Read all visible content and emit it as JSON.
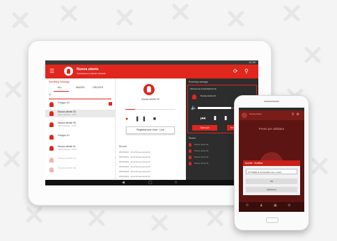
{
  "tablet": {
    "status_time": "12:30",
    "app_title": "Nuova utente",
    "app_subtitle": "Connessa a utente recente",
    "left": {
      "header": "SendMsg message",
      "tabs": [
        "ALL",
        "WAKES",
        "GROUPS"
      ],
      "groups": [
        {
          "name": "Gruppo 10",
          "date": ""
        },
        {
          "name": "Nuova utente 03",
          "date": "Ultimo accesso · 12:00"
        },
        {
          "name": "Nuova utente 05",
          "date": "Ultimo accesso · 12:00"
        },
        {
          "name": "Gruppo 10",
          "date": ""
        },
        {
          "name": "Nuova utente 01",
          "date": "Ultimo accesso · 12:00"
        },
        {
          "name": "Nuova utente 04",
          "date": ""
        },
        {
          "name": "Nuova utente 06",
          "date": ""
        }
      ]
    },
    "middle": {
      "label": "Nuova utente 03",
      "register_button": "Registrazione Voce · Live",
      "recent_label": "Recent",
      "recent_items": [
        "05/15/2016 · 10:12 Nuova utente 02",
        "05/15/2016 · 10:12 Nuova utente 02",
        "05/15/2016 · 10:12 Nuova utente 02",
        "05/15/2016 · 10:12 Nuova utente 02",
        "05/15/2016 · 10:12 Nuova utente 02",
        "05/15/2016 · 10:12 Nuova utente 02"
      ]
    },
    "right": {
      "header": "Receiving message",
      "box_header": "MESSAGE INTERMEDIATE",
      "message_from": "Nuova utente 01",
      "buttons": [
        "Salva pin",
        "Invia Trasmissione"
      ],
      "recent_label": "Recent",
      "recent_items": [
        "Nuova utente 01",
        "Nuova utente 01",
        "Nuova utente 01",
        "Nuova utente 01"
      ]
    }
  },
  "phone": {
    "app_title": "Nuova utente",
    "screen_title": "Premi per abilitare",
    "dialog_title": "Ascolta · Modifica",
    "dialog_text": "ATTIVARE la funzionalità voce e Invia?",
    "dialog_ok": "OK",
    "dialog_cancel": "ANNULLA"
  },
  "colors": {
    "accent": "#e0261d",
    "dark_panel": "#2d2d2d"
  }
}
